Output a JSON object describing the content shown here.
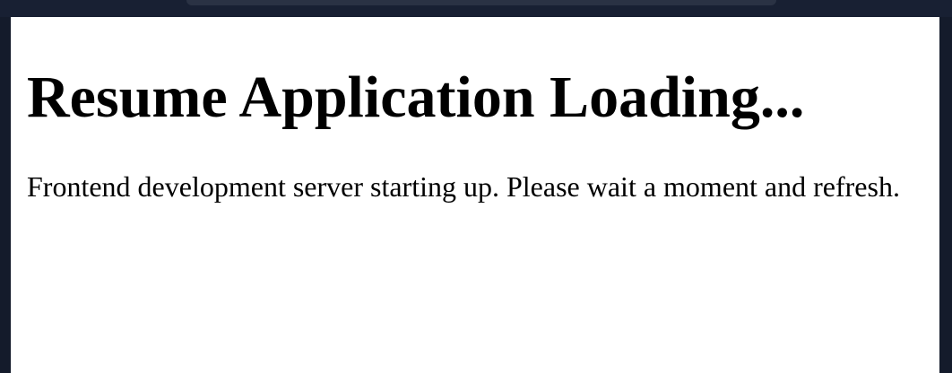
{
  "page": {
    "heading": "Resume Application Loading...",
    "message": "Frontend development server starting up. Please wait a moment and refresh."
  }
}
